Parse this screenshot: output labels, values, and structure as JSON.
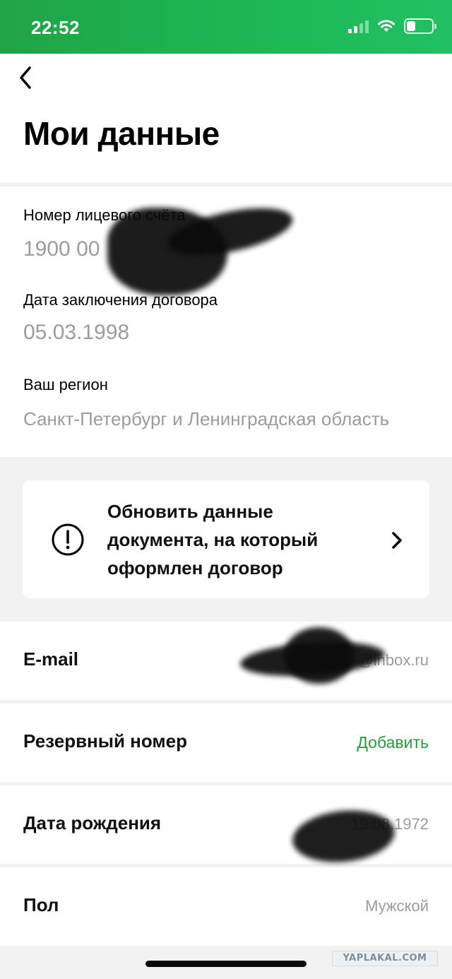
{
  "status_bar": {
    "time": "22:52"
  },
  "header": {
    "title": "Мои данные"
  },
  "account": {
    "number_label": "Номер лицевого счёта",
    "number_value": "1900 00",
    "contract_date_label": "Дата заключения договора",
    "contract_date_value": "05.03.1998",
    "region_label": "Ваш регион",
    "region_value": "Санкт-Петербург и Ленинградская область"
  },
  "update_card": {
    "text": "Обновить данные документа, на который оформлен договор"
  },
  "rows": [
    {
      "label": "E-mail",
      "value": "@inbox.ru"
    },
    {
      "label": "Резервный номер",
      "value": "Добавить"
    },
    {
      "label": "Дата рождения",
      "value": "19.08.1972"
    },
    {
      "label": "Пол",
      "value": "Мужской"
    }
  ],
  "colors": {
    "brand_green": "#21a038",
    "status_bar_green": "#1db954"
  },
  "icons": [
    "back-chevron-icon",
    "alert-circle-icon",
    "chevron-right-icon"
  ],
  "watermark": "YAPLAKAL.COM"
}
